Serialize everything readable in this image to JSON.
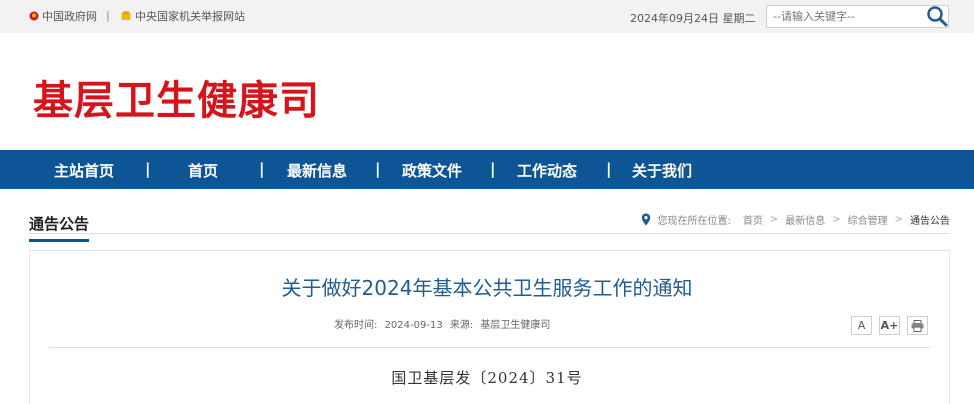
{
  "topbar": {
    "gov_link": "中国政府网",
    "separator": "|",
    "report_link": "中央国家机关举报网站",
    "date": "2024年09月24日 星期二",
    "search_placeholder": "--请输入关键字--"
  },
  "header": {
    "site_title": "基层卫生健康司"
  },
  "nav": {
    "items": [
      "主站首页",
      "首页",
      "最新信息",
      "政策文件",
      "工作动态",
      "关于我们"
    ],
    "separator": "|"
  },
  "section": {
    "title": "通告公告",
    "location_label": "您现在所在位置:",
    "breadcrumbs": [
      "首页",
      "最新信息",
      "综合管理",
      "通告公告"
    ],
    "chevron": ">"
  },
  "article": {
    "title": "关于做好2024年基本公共卫生服务工作的通知",
    "publish_label": "发布时间:",
    "publish_date": "2024-09-13",
    "source_label": "来源:",
    "source": "基层卫生健康司",
    "font_small_label": "A",
    "font_large_label": "A+",
    "doc_number": "国卫基层发〔2024〕31号"
  },
  "colors": {
    "title_red": "#d4161c",
    "nav_blue": "#0d5594",
    "article_title_blue": "#1f5d92"
  }
}
